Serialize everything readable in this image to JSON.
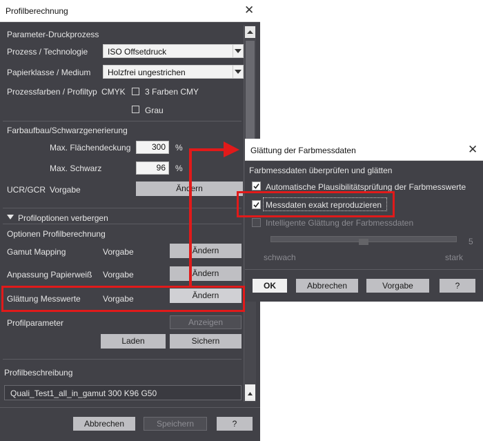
{
  "main_window": {
    "title": "Profilberechnung",
    "section_param": "Parameter-Druckprozess",
    "process_label": "Prozess / Technologie",
    "process_value": "ISO Offsetdruck",
    "paper_label": "Papierklasse / Medium",
    "paper_value": "Holzfrei ungestrichen",
    "process_colors_label": "Prozessfarben / Profiltyp",
    "cmyk": "CMYK",
    "three_colors_label": "3 Farben CMY",
    "gray_label": "Grau",
    "section_farbaufbau": "Farbaufbau/Schwarzgenerierung",
    "max_area_label": "Max. Flächendeckung",
    "max_area_value": "300",
    "max_black_label": "Max. Schwarz",
    "max_black_value": "96",
    "percent": "%",
    "ucr_label": "UCR/GCR",
    "ucr_value": "Vorgabe",
    "change_label": "Ändern",
    "profile_options_toggle": "Profiloptionen verbergen",
    "options_title": "Optionen Profilberechnung",
    "gamut_label": "Gamut Mapping",
    "gamut_value": "Vorgabe",
    "paperwhite_label": "Anpassung Papierweiß",
    "paperwhite_value": "Vorgabe",
    "smoothing_label": "Glättung Messwerte",
    "smoothing_value": "Vorgabe",
    "profile_params_label": "Profilparameter",
    "show_label": "Anzeigen",
    "load_label": "Laden",
    "save_label": "Sichern",
    "description_label": "Profilbeschreibung",
    "description_value": "Quali_Test1_all_in_gamut 300 K96 G50",
    "cancel_label": "Abbrechen",
    "store_label": "Speichern",
    "help_label": "?"
  },
  "dialog": {
    "title": "Glättung der Farbmessdaten",
    "heading": "Farbmessdaten überprüfen und glätten",
    "auto_check_label": "Automatische Plausibilitätsprüfung der Farbmesswerte",
    "exact_label": "Messdaten exakt reproduzieren",
    "smart_label": "Intelligente Glättung der Farbmessdaten",
    "slider_value": "5",
    "weak_label": "schwach",
    "strong_label": "stark",
    "ok_label": "OK",
    "cancel_label": "Abbrechen",
    "default_label": "Vorgabe",
    "help_label": "?"
  },
  "colors": {
    "highlight": "#e11a1a",
    "window_bg": "#414147"
  }
}
